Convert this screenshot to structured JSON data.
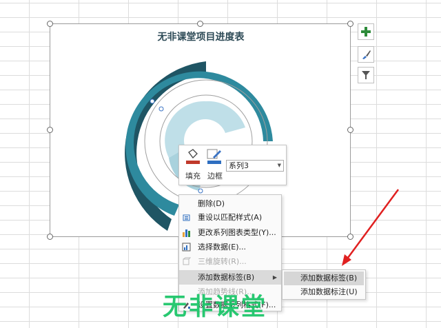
{
  "chart": {
    "title": "无非课堂项目进度表",
    "colors": {
      "series1": "#1f5564",
      "series2": "#2e8a9e",
      "series3": "#bfdfe8",
      "series4_outline": "#a0a0a0"
    }
  },
  "side_buttons": [
    {
      "name": "chart-elements-button",
      "icon": "plus-icon"
    },
    {
      "name": "chart-styles-button",
      "icon": "brush-icon"
    },
    {
      "name": "chart-filters-button",
      "icon": "filter-icon"
    }
  ],
  "mini_toolbar": {
    "fill_label": "填充",
    "outline_label": "边框",
    "series_select": "系列3",
    "fill_color": "#c0392b",
    "outline_color": "#2e6ec0"
  },
  "context_menu": {
    "items": [
      {
        "label": "删除(D)",
        "icon": "",
        "enabled": true
      },
      {
        "label": "重设以匹配样式(A)",
        "icon": "reset-style-icon",
        "enabled": true
      },
      {
        "label": "更改系列图表类型(Y)...",
        "icon": "bar-chart-icon",
        "enabled": true
      },
      {
        "label": "选择数据(E)...",
        "icon": "select-data-icon",
        "enabled": true
      },
      {
        "label": "三维旋转(R)...",
        "icon": "rotate-3d-icon",
        "enabled": false
      },
      {
        "label": "添加数据标签(B)",
        "icon": "",
        "enabled": true,
        "submenu": true
      },
      {
        "label": "添加趋势线(R)...",
        "icon": "",
        "enabled": false
      },
      {
        "label": "设置数据系列格式(F)...",
        "icon": "format-series-icon",
        "enabled": true
      }
    ]
  },
  "submenu": {
    "items": [
      {
        "label": "添加数据标签(B)"
      },
      {
        "label": "添加数据标注(U)"
      }
    ]
  },
  "watermark": "无非课堂"
}
